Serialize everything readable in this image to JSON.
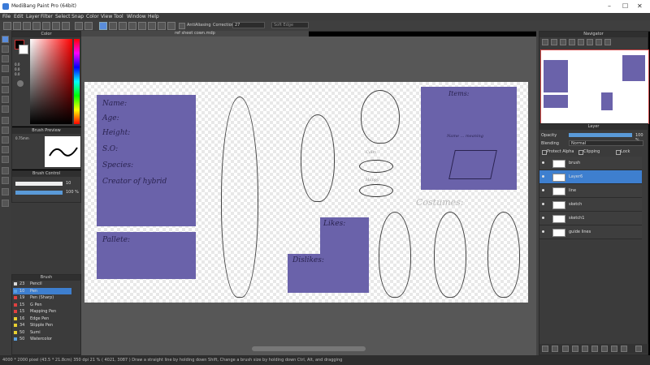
{
  "window": {
    "title": "MediBang Paint Pro (64bit)"
  },
  "menu": [
    "File",
    "Edit",
    "Layer",
    "Filter",
    "Select",
    "Snap",
    "Color",
    "View",
    "Tool",
    "Window",
    "Help"
  ],
  "toolbar": {
    "antialiasing_label": "AntiAliasing",
    "correction_label": "Correction",
    "correction_value": "27",
    "soft_edge_label": "Soft Edge"
  },
  "document": {
    "tab_label": "ref sheet cown.mdp"
  },
  "panels": {
    "color": {
      "title": "Color",
      "r": "0.0",
      "g": "0.0",
      "b": "0.0"
    },
    "brush_preview": {
      "title": "Brush Preview",
      "size_text": "0.75mm"
    },
    "brush_control": {
      "title": "Brush Control",
      "size_value": "10",
      "opacity_value": "100 %"
    },
    "brush": {
      "title": "Brush",
      "items": [
        {
          "num": "23",
          "label": "Pencil",
          "color": "#d9d9d9"
        },
        {
          "num": "10",
          "label": "Pen",
          "color": "#5aa0e0"
        },
        {
          "num": "19",
          "label": "Pen (Sharp)",
          "color": "#e04040"
        },
        {
          "num": "15",
          "label": "G Pen",
          "color": "#e04040"
        },
        {
          "num": "15",
          "label": "Mapping Pen",
          "color": "#e04040"
        },
        {
          "num": "16",
          "label": "Edge Pen",
          "color": "#e8d030"
        },
        {
          "num": "34",
          "label": "Stipple Pen",
          "color": "#e8d030"
        },
        {
          "num": "50",
          "label": "Sumi",
          "color": "#e8d030"
        },
        {
          "num": "50",
          "label": "Watercolor",
          "color": "#5aa0e0"
        }
      ]
    },
    "navigator": {
      "title": "Navigator"
    },
    "layer": {
      "title": "Layer",
      "opacity_label": "Opacity",
      "opacity_value": "100 %",
      "blending_label": "Blending",
      "blending_value": "Normal",
      "protect_alpha": "Protect Alpha",
      "clipping": "Clipping",
      "lock": "Lock",
      "layers": [
        "brush",
        "Layer6",
        "line",
        "sketch",
        "sketch1",
        "guide lines"
      ]
    }
  },
  "canvas_text": {
    "name": "Name:",
    "age": "Age:",
    "height": "Height:",
    "so": "S.O:",
    "species": "Species:",
    "creator": "Creator of hybrid",
    "pallete": "Pallete:",
    "likes": "Likes:",
    "dislikes": "Dislikes:",
    "items": "Items:",
    "costumes": "Costumes:",
    "calm": "Calm",
    "happy": "Happy",
    "items_note": "Name ... meaning"
  },
  "statusbar": {
    "text": "4000 * 2000 pixel  (43.5 * 21.8cm)  350 dpi  21 %  ( 4021, 3087 )  Draw a straight line by holding down Shift, Change a brush size by holding down Ctrl, Alt, and dragging"
  }
}
